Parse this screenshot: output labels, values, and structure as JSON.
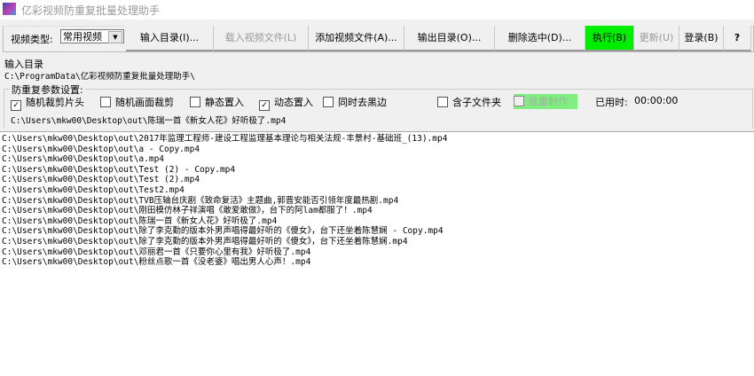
{
  "window": {
    "title": "亿彩视频防重复批量处理助手"
  },
  "toolbar": {
    "video_type_label": "视频类型:",
    "video_type_value": "常用视频",
    "input_dir": "输入目录(I)...",
    "load_files": "载入视频文件(L)",
    "add_files": "添加视频文件(A)...",
    "output_dir": "输出目录(O)...",
    "delete_selected": "删除选中(D)...",
    "execute": "执行(B)",
    "update": "更新(U)",
    "login": "登录(B)",
    "help": "?"
  },
  "input_dir": {
    "label": "输入目录",
    "path": "C:\\ProgramData\\亿彩视频防重复批量处理助手\\"
  },
  "settings": {
    "group_title": "防重复参数设置:",
    "options": [
      {
        "label": "随机裁剪片头",
        "checked": true
      },
      {
        "label": "随机画面裁剪",
        "checked": false
      },
      {
        "label": "静态置入",
        "checked": false
      },
      {
        "label": "动态置入",
        "checked": true
      },
      {
        "label": "同时去黑边",
        "checked": false
      },
      {
        "label": "含子文件夹",
        "checked": false
      },
      {
        "label": "批量制作",
        "checked": false
      }
    ],
    "elapsed_label": "已用时:",
    "elapsed_value": "00:00:00",
    "current_file": "C:\\Users\\mkw00\\Desktop\\out\\陈瑞一首《新女人花》好听极了.mp4"
  },
  "colors": {
    "execute_bg": "#00ee00",
    "batch_bg": "#80ee80"
  },
  "files": [
    "C:\\Users\\mkw00\\Desktop\\out\\2017年监理工程师-建设工程监理基本理论与相关法规-丰景村-基础班_(13).mp4",
    "C:\\Users\\mkw00\\Desktop\\out\\a - Copy.mp4",
    "C:\\Users\\mkw00\\Desktop\\out\\a.mp4",
    "C:\\Users\\mkw00\\Desktop\\out\\Test (2) - Copy.mp4",
    "C:\\Users\\mkw00\\Desktop\\out\\Test (2).mp4",
    "C:\\Users\\mkw00\\Desktop\\out\\Test2.mp4",
    "C:\\Users\\mkw00\\Desktop\\out\\TVB压轴台庆剧《致命复活》主题曲,郭晋安能否引领年度最热剧.mp4",
    "C:\\Users\\mkw00\\Desktop\\out\\刚田模仿林子祥演唱《敢爱敢做》，台下的阿lam都服了！.mp4",
    "C:\\Users\\mkw00\\Desktop\\out\\陈瑞一首《新女人花》好听极了.mp4",
    "C:\\Users\\mkw00\\Desktop\\out\\除了李克勤的版本外男声唱得最好听的《傻女》，台下还坐着陈慧娴 - Copy.mp4",
    "C:\\Users\\mkw00\\Desktop\\out\\除了李克勤的版本外男声唱得最好听的《傻女》，台下还坐着陈慧娴.mp4",
    "C:\\Users\\mkw00\\Desktop\\out\\邓丽君一首《只要你心里有我》好听极了.mp4",
    "C:\\Users\\mkw00\\Desktop\\out\\粉丝点歌一首《没老婆》唱出男人心声！.mp4"
  ]
}
